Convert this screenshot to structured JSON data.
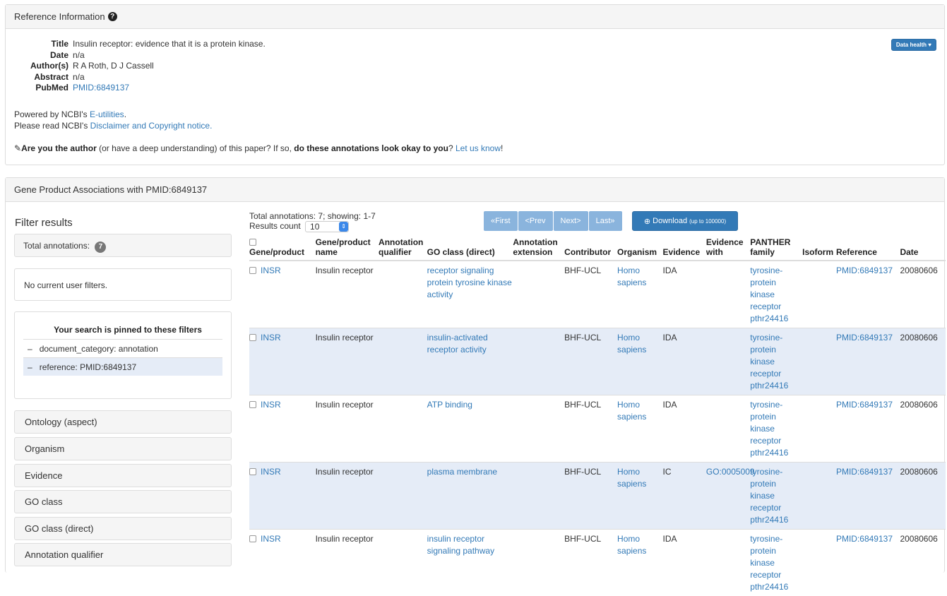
{
  "ref_panel": {
    "heading": "Reference Information",
    "help_icon": "question-circle-icon",
    "fields": [
      {
        "label": "Title",
        "value": "Insulin receptor: evidence that it is a protein kinase."
      },
      {
        "label": "Date",
        "value": "n/a"
      },
      {
        "label": "Author(s)",
        "value": "R A Roth, D J Cassell"
      },
      {
        "label": "Abstract",
        "value": "n/a"
      },
      {
        "label": "PubMed",
        "value": "PMID:6849137"
      }
    ],
    "data_health_label": "Data health ♥",
    "powered_prefix": "Powered by NCBI's ",
    "powered_link": "E-utilities",
    "powered_suffix": ".",
    "read_prefix": "Please read NCBI's ",
    "read_link": "Disclaimer and Copyright notice.",
    "author_icon": "pencil-icon",
    "author_bold1": "Are you the author",
    "author_mid": " (or have a deep understanding) of this paper? If so, ",
    "author_bold2": "do these annotations look okay to you",
    "author_q": "? ",
    "author_link": "Let us know",
    "author_end": "!"
  },
  "assoc_panel": {
    "heading": "Gene Product Associations with PMID:6849137"
  },
  "filters": {
    "title": "Filter results",
    "total_label": "Total annotations:",
    "total_count": "7",
    "no_filters": "No current user filters.",
    "pinned_title": "Your search is pinned to these filters",
    "pinned": [
      {
        "dash": "–",
        "text": "document_category: annotation"
      },
      {
        "dash": "–",
        "text": "reference: PMID:6849137"
      }
    ],
    "facets": [
      "Ontology (aspect)",
      "Organism",
      "Evidence",
      "GO class",
      "GO class (direct)",
      "Annotation qualifier"
    ]
  },
  "results": {
    "totals_text": "Total annotations: 7; showing: 1-7",
    "count_label": "Results count",
    "count_value": "10",
    "pager": [
      "«First",
      "<Prev",
      "Next>",
      "Last»"
    ],
    "download_label": "Download",
    "download_small": "(up to 100000)",
    "columns": {
      "gene": "Gene/product",
      "name": "Gene/product name",
      "qualifier": "Annotation qualifier",
      "go": "GO class (direct)",
      "ext": "Annotation extension",
      "contrib": "Contributor",
      "org": "Organism",
      "evidence": "Evidence",
      "with": "Evidence with",
      "panther": "PANTHER family",
      "isoform": "Isoform",
      "ref": "Reference",
      "date": "Date"
    },
    "rows": [
      {
        "gene": "INSR",
        "name": "Insulin receptor",
        "qualifier": "",
        "go": "receptor signaling protein tyrosine kinase activity",
        "ext": "",
        "contrib": "BHF-UCL",
        "org": "Homo sapiens",
        "evidence": "IDA",
        "with": "",
        "panther": "tyrosine-protein kinase receptor pthr24416",
        "isoform": "",
        "ref": "PMID:6849137",
        "date": "20080606"
      },
      {
        "gene": "INSR",
        "name": "Insulin receptor",
        "qualifier": "",
        "go": "insulin-activated receptor activity",
        "ext": "",
        "contrib": "BHF-UCL",
        "org": "Homo sapiens",
        "evidence": "IDA",
        "with": "",
        "panther": "tyrosine-protein kinase receptor pthr24416",
        "isoform": "",
        "ref": "PMID:6849137",
        "date": "20080606"
      },
      {
        "gene": "INSR",
        "name": "Insulin receptor",
        "qualifier": "",
        "go": "ATP binding",
        "ext": "",
        "contrib": "BHF-UCL",
        "org": "Homo sapiens",
        "evidence": "IDA",
        "with": "",
        "panther": "tyrosine-protein kinase receptor pthr24416",
        "isoform": "",
        "ref": "PMID:6849137",
        "date": "20080606"
      },
      {
        "gene": "INSR",
        "name": "Insulin receptor",
        "qualifier": "",
        "go": "plasma membrane",
        "ext": "",
        "contrib": "BHF-UCL",
        "org": "Homo sapiens",
        "evidence": "IC",
        "with": "GO:0005009",
        "panther": "tyrosine-protein kinase receptor pthr24416",
        "isoform": "",
        "ref": "PMID:6849137",
        "date": "20080606"
      },
      {
        "gene": "INSR",
        "name": "Insulin receptor",
        "qualifier": "",
        "go": "insulin receptor signaling pathway",
        "ext": "",
        "contrib": "BHF-UCL",
        "org": "Homo sapiens",
        "evidence": "IDA",
        "with": "",
        "panther": "tyrosine-protein kinase receptor pthr24416",
        "isoform": "",
        "ref": "PMID:6849137",
        "date": "20080606"
      }
    ]
  }
}
